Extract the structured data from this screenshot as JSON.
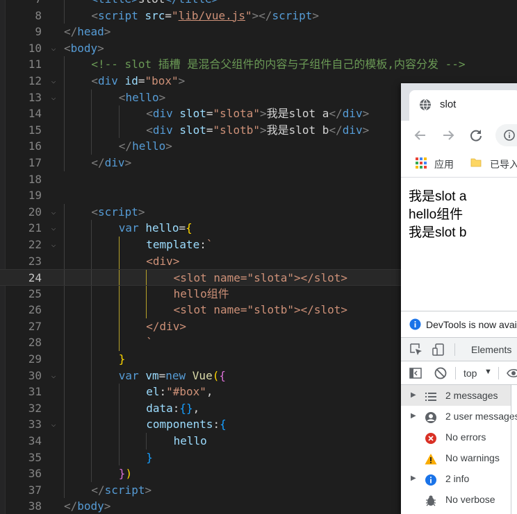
{
  "editor": {
    "current_line": 24,
    "lines": [
      {
        "n": 7,
        "fold": false,
        "indent": 1,
        "tokens": [
          [
            "tag",
            "<title>"
          ],
          [
            "txt",
            "slot"
          ],
          [
            "tag",
            "</title>"
          ]
        ]
      },
      {
        "n": 8,
        "fold": false,
        "indent": 1,
        "tokens": [
          [
            "pun",
            "<"
          ],
          [
            "tag",
            "script"
          ],
          [
            "txt",
            " "
          ],
          [
            "attr",
            "src"
          ],
          [
            "txt",
            "="
          ],
          [
            "str",
            "\""
          ],
          [
            "stru",
            "lib/vue.js"
          ],
          [
            "str",
            "\""
          ],
          [
            "pun",
            ">"
          ],
          [
            "pun",
            "</"
          ],
          [
            "tag",
            "script"
          ],
          [
            "pun",
            ">"
          ]
        ]
      },
      {
        "n": 9,
        "fold": false,
        "indent": 0,
        "tokens": [
          [
            "pun",
            "</"
          ],
          [
            "tag",
            "head"
          ],
          [
            "pun",
            ">"
          ]
        ]
      },
      {
        "n": 10,
        "fold": true,
        "indent": 0,
        "tokens": [
          [
            "pun",
            "<"
          ],
          [
            "tag",
            "body"
          ],
          [
            "pun",
            ">"
          ]
        ]
      },
      {
        "n": 11,
        "fold": false,
        "indent": 1,
        "tokens": [
          [
            "com",
            "<!-- slot 插槽 是混合父组件的内容与子组件自己的模板,内容分发 -->"
          ]
        ]
      },
      {
        "n": 12,
        "fold": true,
        "indent": 1,
        "tokens": [
          [
            "pun",
            "<"
          ],
          [
            "tag",
            "div"
          ],
          [
            "txt",
            " "
          ],
          [
            "attr",
            "id"
          ],
          [
            "txt",
            "="
          ],
          [
            "str",
            "\"box\""
          ],
          [
            "pun",
            ">"
          ]
        ]
      },
      {
        "n": 13,
        "fold": true,
        "indent": 2,
        "tokens": [
          [
            "pun",
            "<"
          ],
          [
            "tag",
            "hello"
          ],
          [
            "pun",
            ">"
          ]
        ]
      },
      {
        "n": 14,
        "fold": false,
        "indent": 3,
        "tokens": [
          [
            "pun",
            "<"
          ],
          [
            "tag",
            "div"
          ],
          [
            "txt",
            " "
          ],
          [
            "attr",
            "slot"
          ],
          [
            "txt",
            "="
          ],
          [
            "str",
            "\"slota\""
          ],
          [
            "pun",
            ">"
          ],
          [
            "txt",
            "我是slot a"
          ],
          [
            "pun",
            "</"
          ],
          [
            "tag",
            "div"
          ],
          [
            "pun",
            ">"
          ]
        ]
      },
      {
        "n": 15,
        "fold": false,
        "indent": 3,
        "tokens": [
          [
            "pun",
            "<"
          ],
          [
            "tag",
            "div"
          ],
          [
            "txt",
            " "
          ],
          [
            "attr",
            "slot"
          ],
          [
            "txt",
            "="
          ],
          [
            "str",
            "\"slotb\""
          ],
          [
            "pun",
            ">"
          ],
          [
            "txt",
            "我是slot b"
          ],
          [
            "pun",
            "</"
          ],
          [
            "tag",
            "div"
          ],
          [
            "pun",
            ">"
          ]
        ]
      },
      {
        "n": 16,
        "fold": false,
        "indent": 2,
        "tokens": [
          [
            "pun",
            "</"
          ],
          [
            "tag",
            "hello"
          ],
          [
            "pun",
            ">"
          ]
        ]
      },
      {
        "n": 17,
        "fold": false,
        "indent": 1,
        "tokens": [
          [
            "pun",
            "</"
          ],
          [
            "tag",
            "div"
          ],
          [
            "pun",
            ">"
          ]
        ]
      },
      {
        "n": 18,
        "fold": false,
        "indent": 0,
        "tokens": []
      },
      {
        "n": 19,
        "fold": false,
        "indent": 0,
        "tokens": []
      },
      {
        "n": 20,
        "fold": true,
        "indent": 1,
        "tokens": [
          [
            "pun",
            "<"
          ],
          [
            "tag",
            "script"
          ],
          [
            "pun",
            ">"
          ]
        ]
      },
      {
        "n": 21,
        "fold": true,
        "indent": 2,
        "tokens": [
          [
            "kw",
            "var"
          ],
          [
            "txt",
            " "
          ],
          [
            "var",
            "hello"
          ],
          [
            "txt",
            "="
          ],
          [
            "br1",
            "{"
          ]
        ]
      },
      {
        "n": 22,
        "fold": true,
        "indent": 3,
        "tokens": [
          [
            "var",
            "template"
          ],
          [
            "txt",
            ":"
          ],
          [
            "tpl",
            "`"
          ]
        ]
      },
      {
        "n": 23,
        "fold": false,
        "indent": 3,
        "tokens": [
          [
            "tpl",
            "<div>"
          ]
        ]
      },
      {
        "n": 24,
        "fold": false,
        "indent": 4,
        "tokens": [
          [
            "tpl",
            "<slot name=\"slota\"></slot>"
          ]
        ]
      },
      {
        "n": 25,
        "fold": false,
        "indent": 4,
        "tokens": [
          [
            "tpl",
            "hello组件"
          ]
        ]
      },
      {
        "n": 26,
        "fold": false,
        "indent": 4,
        "tokens": [
          [
            "tpl",
            "<slot name=\"slotb\"></slot>"
          ]
        ]
      },
      {
        "n": 27,
        "fold": false,
        "indent": 3,
        "tokens": [
          [
            "tpl",
            "</div>"
          ]
        ]
      },
      {
        "n": 28,
        "fold": false,
        "indent": 3,
        "tokens": [
          [
            "tpl",
            "`"
          ]
        ]
      },
      {
        "n": 29,
        "fold": false,
        "indent": 2,
        "tokens": [
          [
            "br1",
            "}"
          ]
        ]
      },
      {
        "n": 30,
        "fold": true,
        "indent": 2,
        "tokens": [
          [
            "kw",
            "var"
          ],
          [
            "txt",
            " "
          ],
          [
            "var",
            "vm"
          ],
          [
            "txt",
            "="
          ],
          [
            "kw",
            "new"
          ],
          [
            "txt",
            " "
          ],
          [
            "fn",
            "Vue"
          ],
          [
            "br1",
            "("
          ],
          [
            "br2",
            "{"
          ]
        ]
      },
      {
        "n": 31,
        "fold": false,
        "indent": 3,
        "tokens": [
          [
            "var",
            "el"
          ],
          [
            "txt",
            ":"
          ],
          [
            "str",
            "\"#box\""
          ],
          [
            "txt",
            ","
          ]
        ]
      },
      {
        "n": 32,
        "fold": false,
        "indent": 3,
        "tokens": [
          [
            "var",
            "data"
          ],
          [
            "txt",
            ":"
          ],
          [
            "br3",
            "{}"
          ],
          [
            "txt",
            ","
          ]
        ]
      },
      {
        "n": 33,
        "fold": true,
        "indent": 3,
        "tokens": [
          [
            "var",
            "components"
          ],
          [
            "txt",
            ":"
          ],
          [
            "br3",
            "{"
          ]
        ]
      },
      {
        "n": 34,
        "fold": false,
        "indent": 4,
        "tokens": [
          [
            "var",
            "hello"
          ]
        ]
      },
      {
        "n": 35,
        "fold": false,
        "indent": 3,
        "tokens": [
          [
            "br3",
            "}"
          ]
        ]
      },
      {
        "n": 36,
        "fold": false,
        "indent": 2,
        "tokens": [
          [
            "br2",
            "}"
          ],
          [
            "br1",
            ")"
          ]
        ]
      },
      {
        "n": 37,
        "fold": false,
        "indent": 1,
        "tokens": [
          [
            "pun",
            "</"
          ],
          [
            "tag",
            "script"
          ],
          [
            "pun",
            ">"
          ]
        ]
      },
      {
        "n": 38,
        "fold": false,
        "indent": 0,
        "tokens": [
          [
            "pun",
            "</"
          ],
          [
            "tag",
            "body"
          ],
          [
            "pun",
            ">"
          ]
        ]
      }
    ]
  },
  "browser": {
    "tab_title": "slot",
    "bookmarks": {
      "apps_label": "应用",
      "folder_label": "已导入"
    },
    "page_lines": [
      "我是slot a",
      "hello组件",
      "我是slot b"
    ],
    "devtools": {
      "banner_text": "DevTools is now available in Chinese!",
      "tab_elements": "Elements",
      "context": "top",
      "context_arrow": "▼",
      "rows": [
        {
          "label": "2 messages",
          "icon": "list-icon",
          "arrow": true,
          "selected": true
        },
        {
          "label": "2 user messages",
          "icon": "user-icon",
          "arrow": true,
          "selected": false
        },
        {
          "label": "No errors",
          "icon": "error-icon",
          "arrow": false,
          "selected": false
        },
        {
          "label": "No warnings",
          "icon": "warning-icon",
          "arrow": false,
          "selected": false
        },
        {
          "label": "2 info",
          "icon": "info-icon",
          "arrow": true,
          "selected": false
        },
        {
          "label": "No verbose",
          "icon": "verbose-icon",
          "arrow": false,
          "selected": false
        }
      ]
    }
  }
}
